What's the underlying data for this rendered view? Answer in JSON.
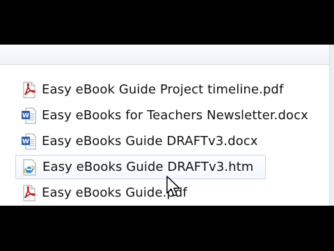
{
  "files": [
    {
      "name": "Easy eBook Guide Project timeline.pdf",
      "type": "pdf"
    },
    {
      "name": "Easy eBooks for Teachers Newsletter.docx",
      "type": "docx"
    },
    {
      "name": "Easy eBooks Guide DRAFTv3.docx",
      "type": "docx"
    },
    {
      "name": "Easy eBooks Guide DRAFTv3.htm",
      "type": "htm"
    },
    {
      "name": "Easy eBooks Guide.pdf",
      "type": "pdf"
    }
  ],
  "colors": {
    "pdf": "#c8201c",
    "word": "#2a5fb0",
    "ie": "#2f8fd6",
    "hover_border": "#c9d6e6"
  }
}
